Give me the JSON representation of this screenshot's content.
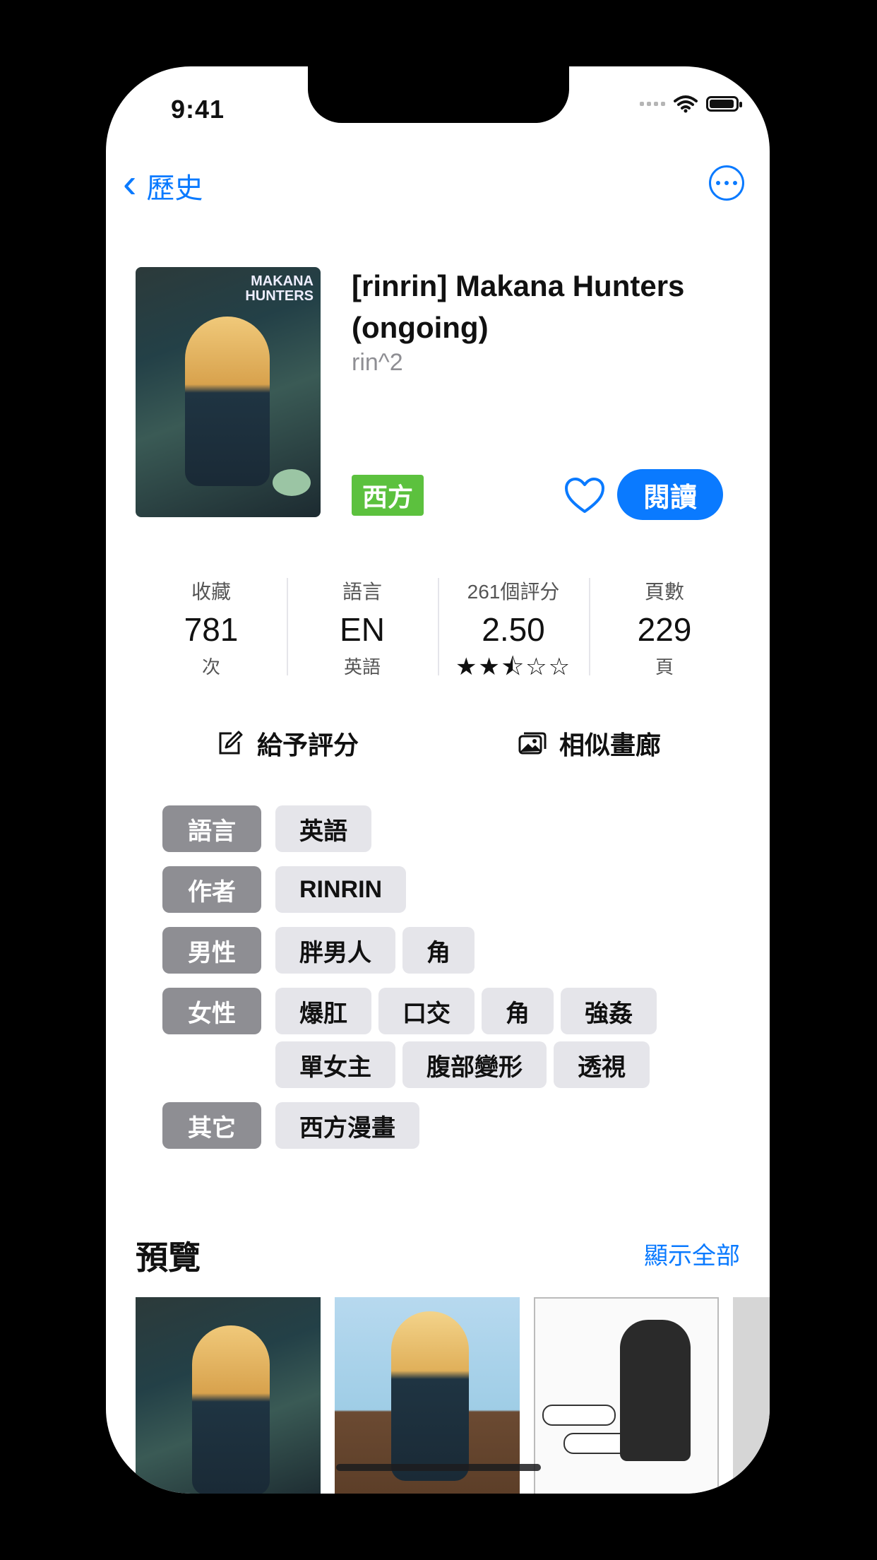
{
  "status": {
    "time": "9:41"
  },
  "nav": {
    "back_label": "歷史"
  },
  "gallery": {
    "title": "[rinrin] Makana Hunters (ongoing)",
    "author": "rin^2",
    "category": "西方",
    "read_label": "閱讀",
    "cover_logo_line1": "MAKANA",
    "cover_logo_line2": "HUNTERS"
  },
  "stats": [
    {
      "label": "收藏",
      "value": "781",
      "sub": "次"
    },
    {
      "label": "語言",
      "value": "EN",
      "sub": "英語"
    },
    {
      "label": "261個評分",
      "value": "2.50",
      "stars": "★★⯪☆☆"
    },
    {
      "label": "頁數",
      "value": "229",
      "sub": "頁"
    }
  ],
  "actions": {
    "rate_label": "給予評分",
    "similar_label": "相似畫廊"
  },
  "tags": [
    {
      "key": "語言",
      "values": [
        "英語"
      ]
    },
    {
      "key": "作者",
      "values": [
        "RINRIN"
      ]
    },
    {
      "key": "男性",
      "values": [
        "胖男人",
        "角"
      ]
    },
    {
      "key": "女性",
      "values": [
        "爆肛",
        "口交",
        "角",
        "強姦",
        "單女主",
        "腹部變形",
        "透視"
      ]
    },
    {
      "key": "其它",
      "values": [
        "西方漫畫"
      ]
    }
  ],
  "preview": {
    "title": "預覽",
    "show_all": "顯示全部"
  },
  "colors": {
    "accent": "#0a7aff",
    "category": "#5cc13e",
    "tag_key": "#8e8e93",
    "tag_value": "#e5e5ea"
  }
}
